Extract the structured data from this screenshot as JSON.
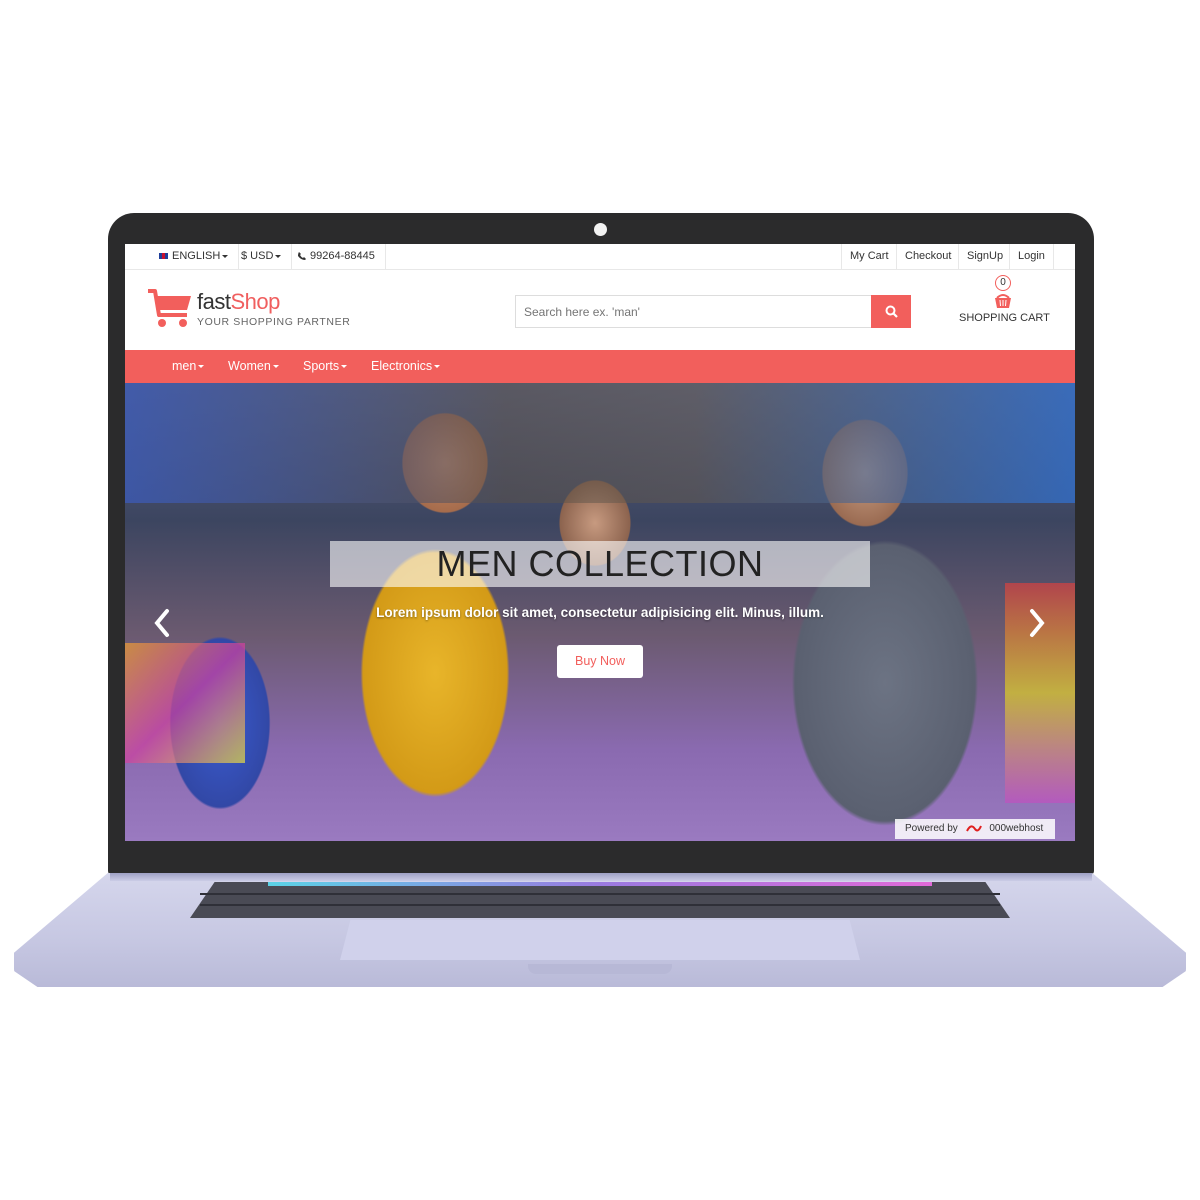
{
  "topbar": {
    "language": "ENGLISH",
    "currency": "$ USD",
    "phone": "99264-88445",
    "links": [
      "My Cart",
      "Checkout",
      "SignUp",
      "Login"
    ]
  },
  "header": {
    "logo_part1": "fast",
    "logo_part2": "Shop",
    "tagline": "YOUR SHOPPING PARTNER",
    "search_placeholder": "Search here ex. 'man'",
    "cart_count": "0",
    "cart_label": "SHOPPING CART"
  },
  "nav": {
    "items": [
      "men",
      "Women",
      "Sports",
      "Electronics"
    ]
  },
  "hero": {
    "title": "MEN COLLECTION",
    "subtitle": "Lorem ipsum dolor sit amet, consectetur adipisicing elit. Minus, illum.",
    "button": "Buy Now",
    "powered_prefix": "Powered by",
    "powered_brand": "000webhost"
  },
  "colors": {
    "accent": "#f25f5c",
    "laptop_frame": "#2b2b2c",
    "laptop_base": "#c6c7e2"
  },
  "icons": [
    "flag-uk-icon",
    "phone-icon",
    "shopping-cart-logo-icon",
    "search-icon",
    "cart-basket-icon",
    "chevron-left-icon",
    "chevron-right-icon",
    "webhost-logo-icon"
  ]
}
